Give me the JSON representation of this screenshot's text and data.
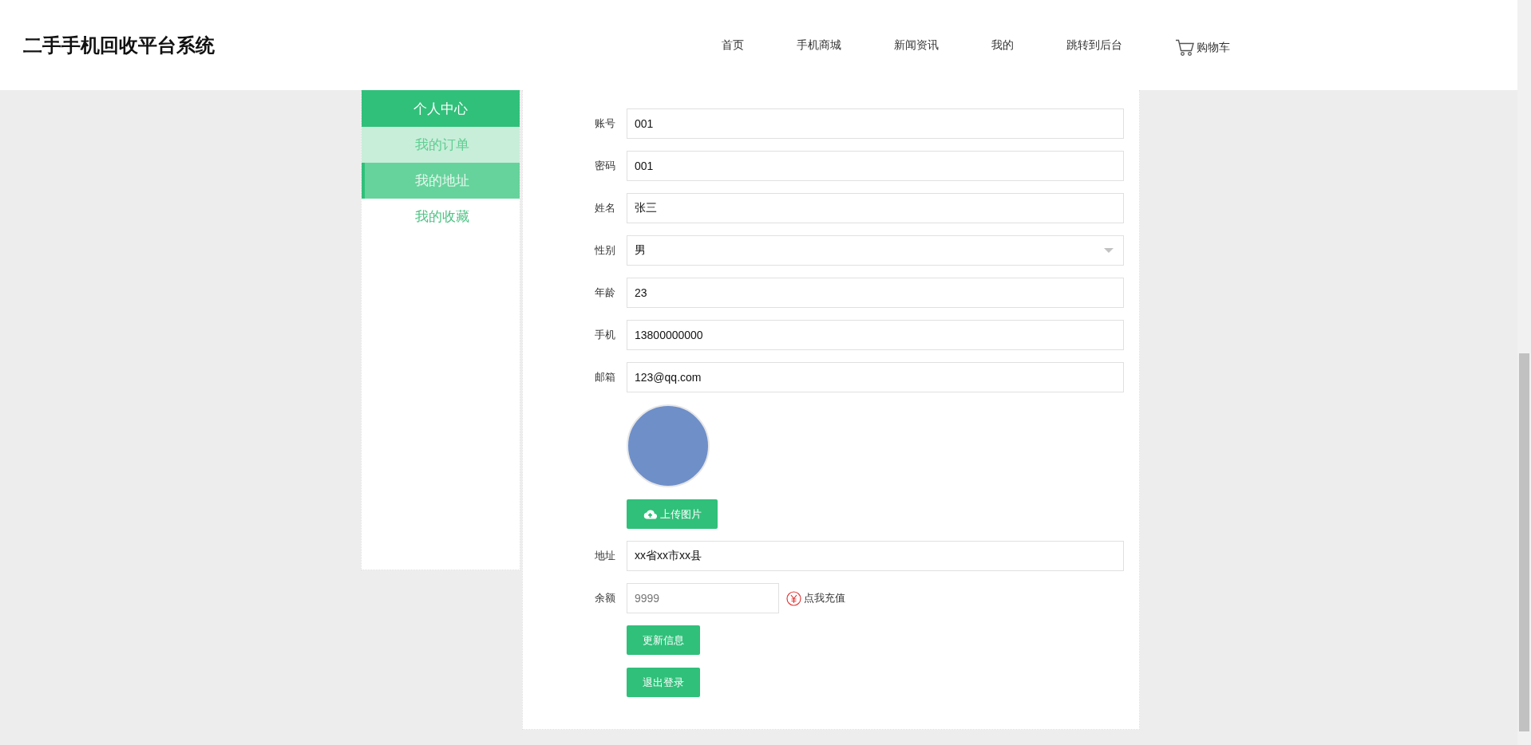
{
  "header": {
    "title": "二手手机回收平台系统",
    "nav": [
      {
        "label": "首页",
        "kind": "link"
      },
      {
        "label": "手机商城",
        "kind": "link"
      },
      {
        "label": "新闻资讯",
        "kind": "link"
      },
      {
        "label": "我的",
        "kind": "link"
      },
      {
        "label": "跳转到后台",
        "kind": "link"
      },
      {
        "label": "购物车",
        "kind": "cart"
      }
    ]
  },
  "sidebar": {
    "title": "个人中心",
    "items": [
      {
        "label": "我的订单",
        "selected": true,
        "hovered": false
      },
      {
        "label": "我的地址",
        "selected": false,
        "hovered": true
      },
      {
        "label": "我的收藏",
        "selected": false,
        "hovered": false
      }
    ]
  },
  "form": {
    "fields": [
      {
        "kind": "input",
        "label": "账号",
        "value": "001"
      },
      {
        "kind": "input",
        "label": "密码",
        "value": "001"
      },
      {
        "kind": "input",
        "label": "姓名",
        "value": "张三"
      },
      {
        "kind": "select",
        "label": "性别",
        "value": "男"
      },
      {
        "kind": "input",
        "label": "年龄",
        "value": "23"
      },
      {
        "kind": "input",
        "label": "手机",
        "value": "13800000000"
      },
      {
        "kind": "input",
        "label": "邮箱",
        "value": "123@qq.com"
      },
      {
        "kind": "avatar",
        "button": "上传图片"
      },
      {
        "kind": "input",
        "label": "地址",
        "value": "xx省xx市xx县"
      },
      {
        "kind": "balance",
        "label": "余额",
        "placeholder": "9999",
        "link": "点我充值"
      }
    ],
    "buttons": [
      "更新信息",
      "退出登录"
    ]
  }
}
